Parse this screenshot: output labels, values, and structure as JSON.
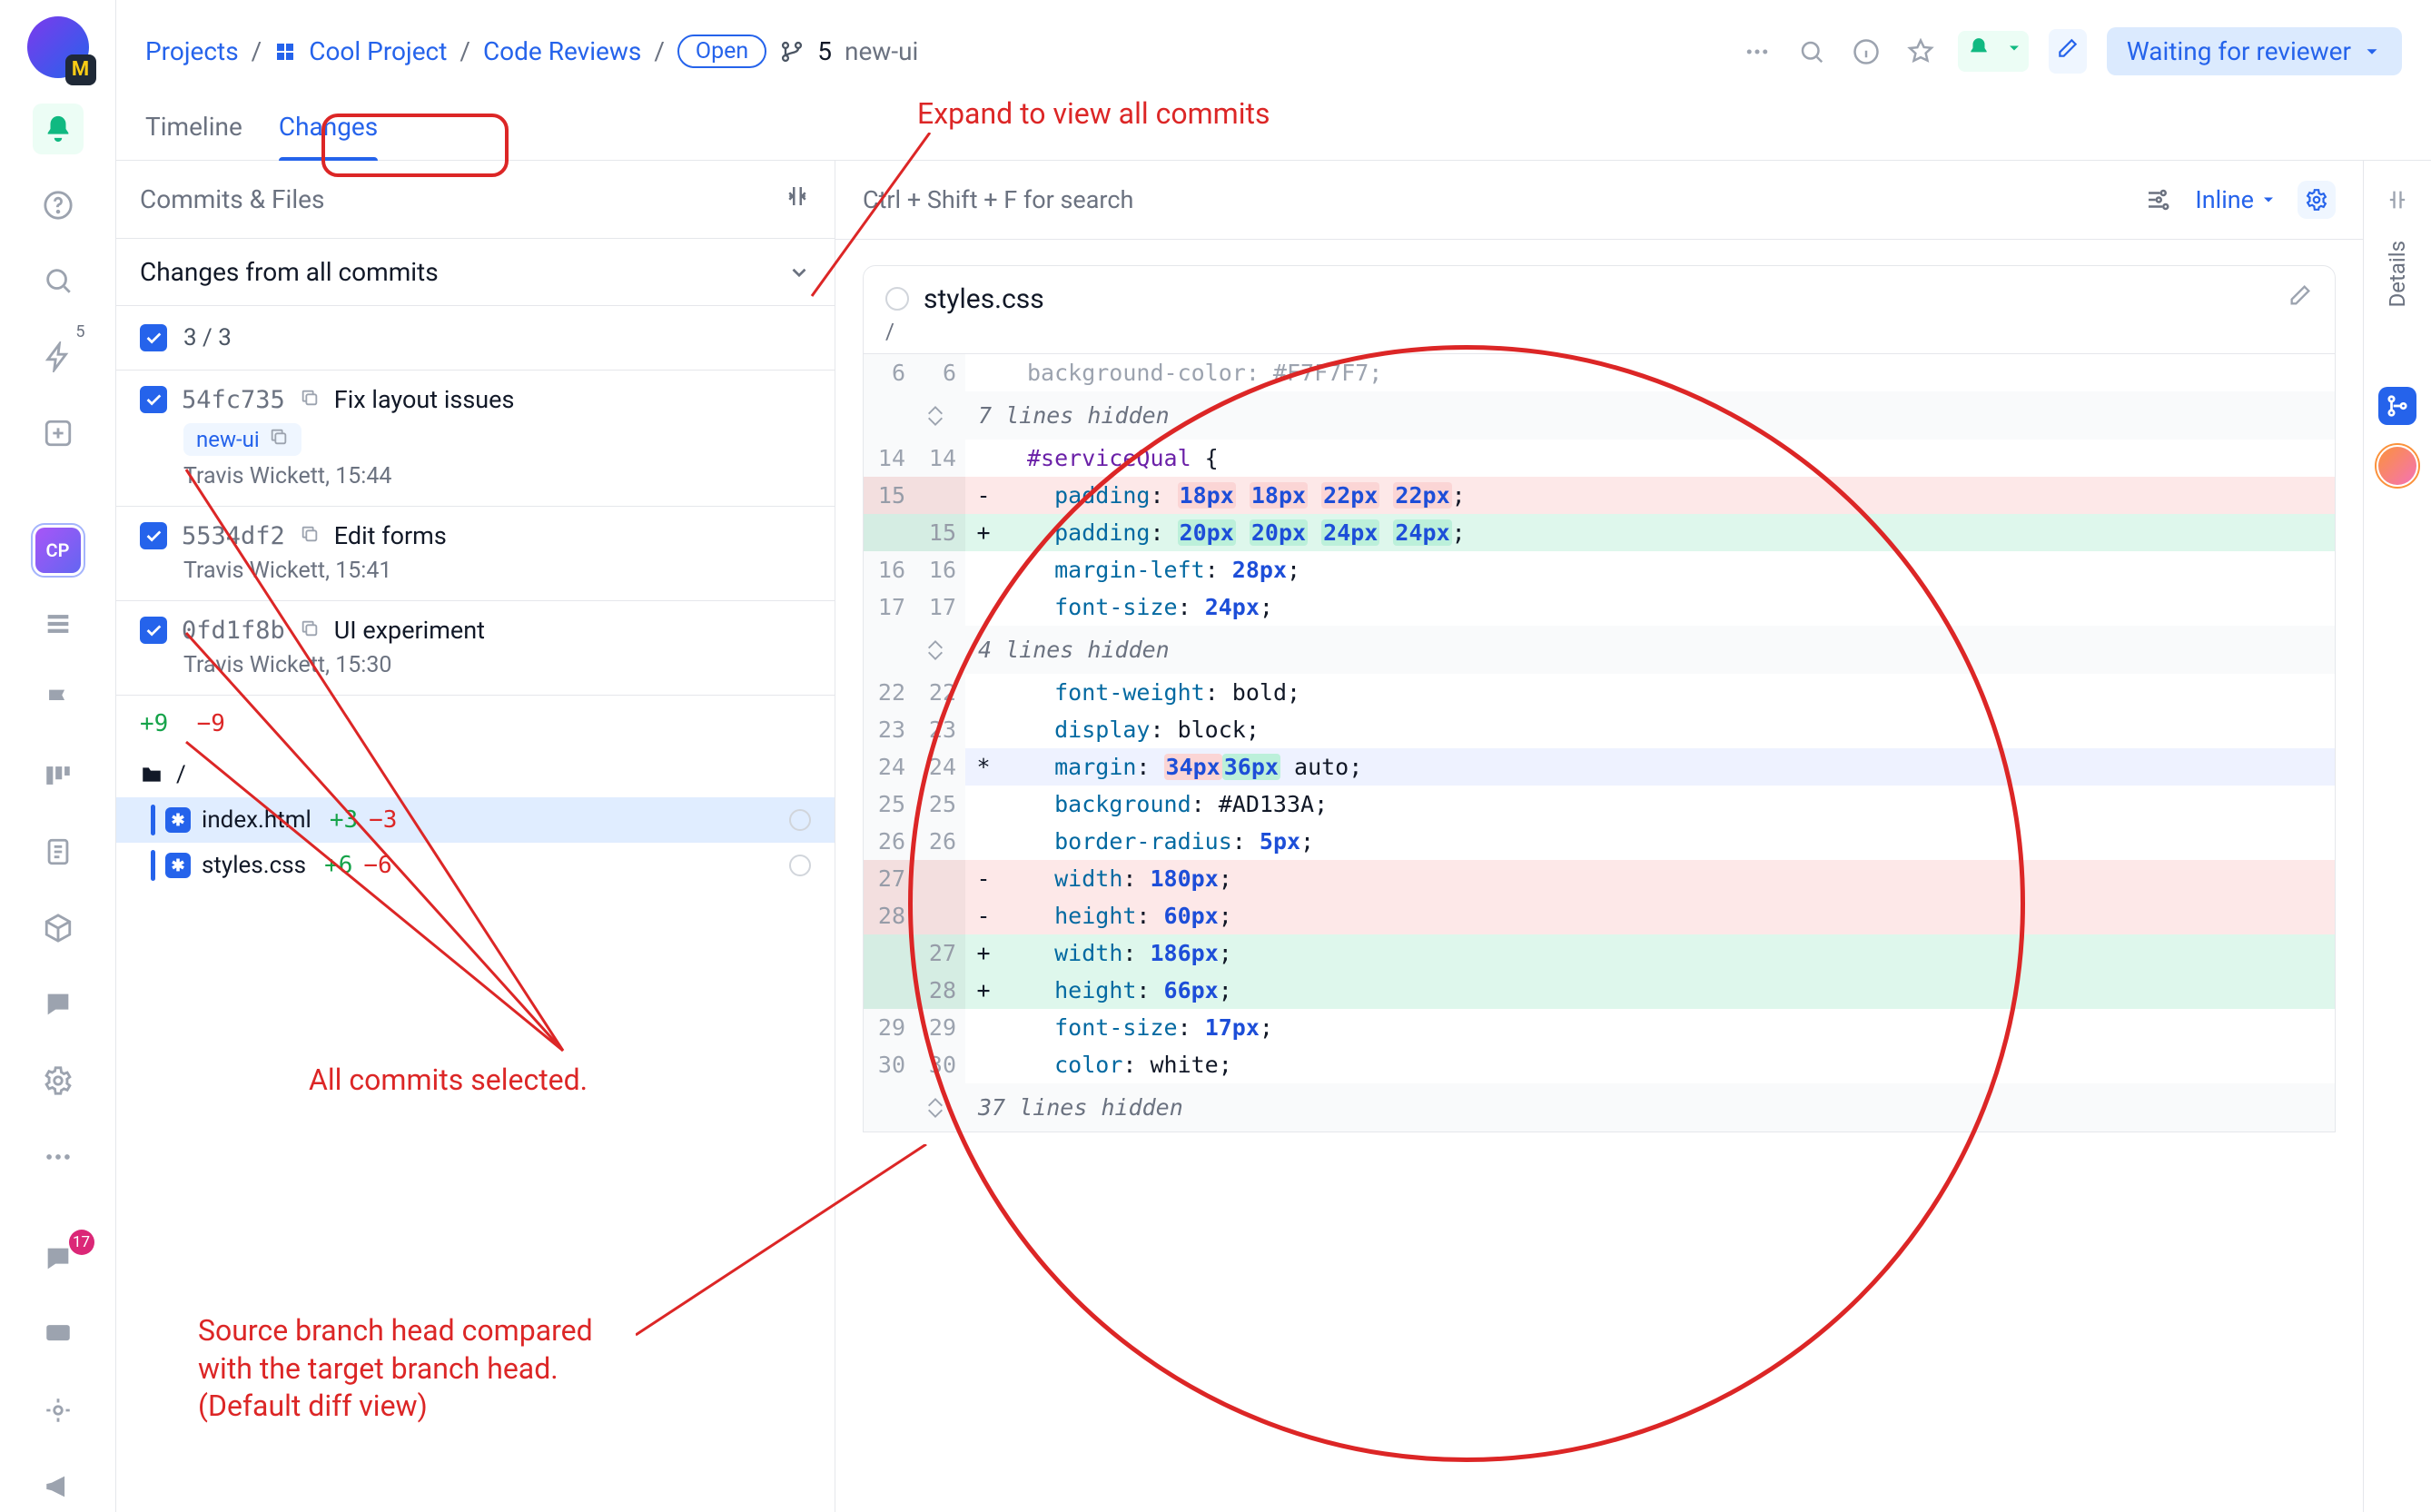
{
  "breadcrumb": {
    "root": "Projects",
    "project": "Cool Project",
    "section": "Code Reviews",
    "status": "Open",
    "branch_count": "5",
    "branch_name": "new-ui"
  },
  "toolbar": {
    "status_label": "Waiting for reviewer"
  },
  "tabs": {
    "timeline": "Timeline",
    "changes": "Changes"
  },
  "commits_panel": {
    "header": "Commits & Files",
    "filter": "Changes from all commits",
    "count": "3 / 3",
    "stats_add": "+9",
    "stats_del": "−9",
    "root_path": "/",
    "commits": [
      {
        "hash": "54fc735",
        "title": "Fix layout issues",
        "branch": "new-ui",
        "meta": "Travis Wickett, 15:44"
      },
      {
        "hash": "5534df2",
        "title": "Edit forms",
        "meta": "Travis Wickett, 15:41"
      },
      {
        "hash": "0fd1f8b",
        "title": "UI experiment",
        "meta": "Travis Wickett, 15:30"
      }
    ],
    "files": [
      {
        "name": "index.html",
        "add": "+3",
        "del": "−3",
        "selected": true
      },
      {
        "name": "styles.css",
        "add": "+6",
        "del": "−6",
        "selected": false
      }
    ]
  },
  "diff_toolbar": {
    "search_hint": "Ctrl + Shift + F for search",
    "mode": "Inline"
  },
  "diff_file": {
    "name": "styles.css",
    "path": "/"
  },
  "diff": {
    "top_context": {
      "l": "6",
      "r": "6",
      "code": "background-color: #F7F7F7;"
    },
    "hidden1": "7 lines hidden",
    "block1": [
      {
        "l": "14",
        "r": "14",
        "type": "ctx",
        "html": "<span class=tok-sel>#serviceQual</span> {"
      },
      {
        "l": "15",
        "r": "",
        "type": "del",
        "html": "  <span class=tok-prop>padding</span>: <span class='tok-val hl-del'>18px</span> <span class='tok-val hl-del'>18px</span> <span class='tok-val hl-del'>22px</span> <span class='tok-val hl-del'>22px</span>;"
      },
      {
        "l": "",
        "r": "15",
        "type": "add",
        "html": "  <span class=tok-prop>padding</span>: <span class='tok-val hl-add'>20px</span> <span class='tok-val hl-add'>20px</span> <span class='tok-val hl-add'>24px</span> <span class='tok-val hl-add'>24px</span>;"
      },
      {
        "l": "16",
        "r": "16",
        "type": "ctx",
        "html": "  <span class=tok-prop>margin-left</span>: <span class=tok-val>28px</span>;"
      },
      {
        "l": "17",
        "r": "17",
        "type": "ctx",
        "html": "  <span class=tok-prop>font-size</span>: <span class=tok-val>24px</span>;"
      }
    ],
    "hidden2": "4 lines hidden",
    "block2": [
      {
        "l": "22",
        "r": "22",
        "type": "ctx",
        "html": "  <span class=tok-prop>font-weight</span>: bold;"
      },
      {
        "l": "23",
        "r": "23",
        "type": "ctx",
        "html": "  <span class=tok-prop>display</span>: block;"
      },
      {
        "l": "24",
        "r": "24",
        "type": "mod",
        "html": "  <span class=tok-prop>margin</span>: <span class='tok-val'><span class=hl-del>34px</span><span class=hl-add>36px</span></span> auto;"
      },
      {
        "l": "25",
        "r": "25",
        "type": "ctx",
        "html": "  <span class=tok-prop>background</span>: #AD133A;"
      },
      {
        "l": "26",
        "r": "26",
        "type": "ctx",
        "html": "  <span class=tok-prop>border-radius</span>: <span class=tok-val>5px</span>;"
      },
      {
        "l": "27",
        "r": "",
        "type": "del",
        "html": "  <span class=tok-prop>width</span>: <span class=tok-val>180px</span>;"
      },
      {
        "l": "28",
        "r": "",
        "type": "del",
        "html": "  <span class=tok-prop>height</span>: <span class=tok-val>60px</span>;"
      },
      {
        "l": "",
        "r": "27",
        "type": "add",
        "html": "  <span class=tok-prop>width</span>: <span class=tok-val>186px</span>;"
      },
      {
        "l": "",
        "r": "28",
        "type": "add",
        "html": "  <span class=tok-prop>height</span>: <span class=tok-val>66px</span>;"
      },
      {
        "l": "29",
        "r": "29",
        "type": "ctx",
        "html": "  <span class=tok-prop>font-size</span>: <span class=tok-val>17px</span>;"
      },
      {
        "l": "30",
        "r": "30",
        "type": "ctx",
        "html": "  <span class=tok-prop>color</span>: white;"
      }
    ],
    "hidden3": "37 lines hidden"
  },
  "right_rail": {
    "label": "Details"
  },
  "rail_badge_count": "17",
  "rail_bolt_count": "5",
  "annotations": {
    "a1": "Expand to view all commits",
    "a2": "All commits selected.",
    "a3_l1": "Source branch head compared",
    "a3_l2": "with the target branch head.",
    "a3_l3": "(Default diff view)"
  }
}
